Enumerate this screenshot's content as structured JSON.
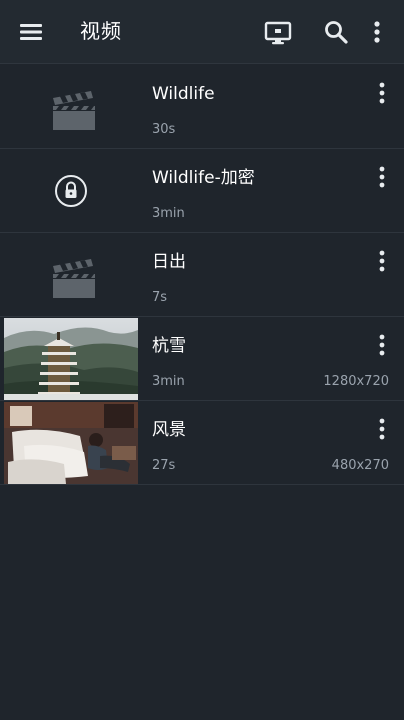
{
  "appbar": {
    "title": "视频",
    "menu_icon": "hamburger-menu-icon",
    "cast_icon": "cast-screen-icon",
    "search_icon": "search-icon",
    "overflow_icon": "more-vertical-icon"
  },
  "colors": {
    "background": "#1f252c",
    "appbar": "#232a31",
    "secondary_text": "#9aa3ad",
    "icon": "#e8ecef"
  },
  "videos": [
    {
      "name": "Wildlife",
      "duration": "30s",
      "resolution": "",
      "thumbnail": "clapperboard-icon"
    },
    {
      "name": "Wildlife-加密",
      "duration": "3min",
      "resolution": "",
      "thumbnail": "lock-icon"
    },
    {
      "name": "日出",
      "duration": "7s",
      "resolution": "",
      "thumbnail": "clapperboard-icon"
    },
    {
      "name": "杭雪",
      "duration": "3min",
      "resolution": "1280x720",
      "thumbnail": "pagoda-snow-thumbnail"
    },
    {
      "name": "风景",
      "duration": "27s",
      "resolution": "480x270",
      "thumbnail": "living-room-thumbnail"
    }
  ]
}
